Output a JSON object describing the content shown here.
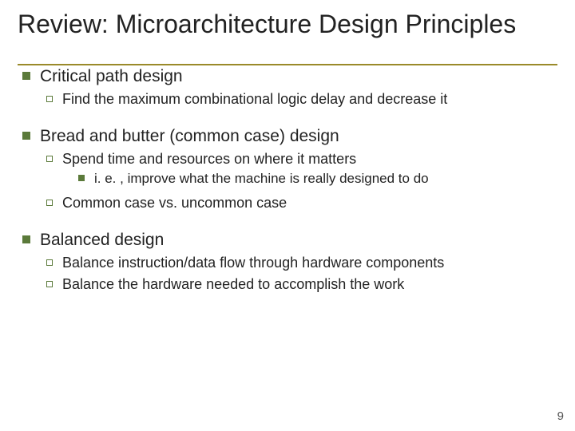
{
  "title": "Review: Microarchitecture Design Principles",
  "sections": [
    {
      "heading": "Critical path design",
      "subs": [
        {
          "text": "Find the maximum combinational logic delay and decrease it"
        }
      ]
    },
    {
      "heading": "Bread and butter (common case) design",
      "subs": [
        {
          "text": "Spend time and resources on where it matters",
          "subsubs": [
            {
              "text": "i. e. , improve what the machine is really designed to do"
            }
          ]
        },
        {
          "text": "Common case vs. uncommon case"
        }
      ]
    },
    {
      "heading": "Balanced design",
      "subs": [
        {
          "text": "Balance instruction/data flow through hardware components"
        },
        {
          "text": "Balance the hardware needed to accomplish the work"
        }
      ]
    }
  ],
  "page_number": "9"
}
